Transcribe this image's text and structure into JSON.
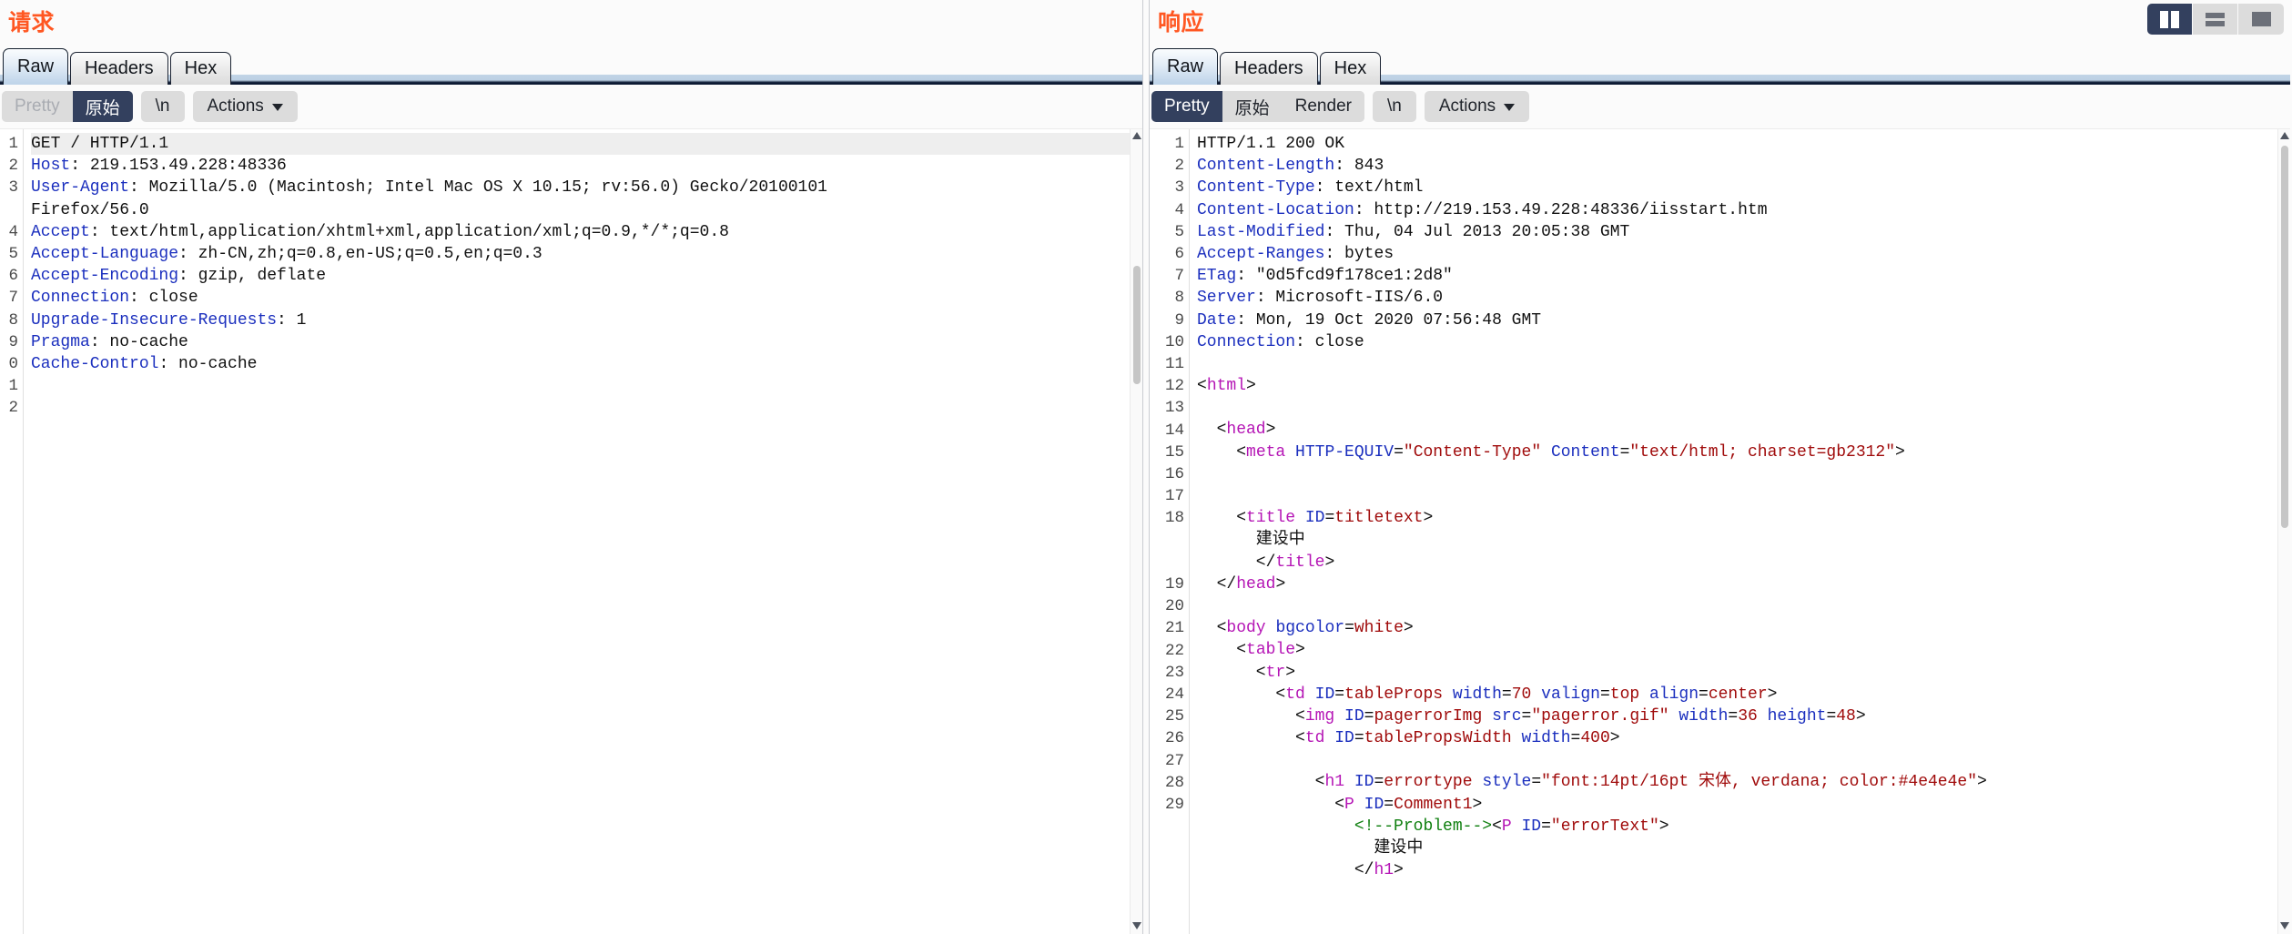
{
  "layout_buttons": [
    {
      "name": "vertical-split",
      "selected": true
    },
    {
      "name": "horizontal-split",
      "selected": false
    },
    {
      "name": "single-pane",
      "selected": false
    }
  ],
  "request": {
    "title": "请求",
    "tabs": [
      {
        "label": "Raw",
        "active": true
      },
      {
        "label": "Headers",
        "active": false
      },
      {
        "label": "Hex",
        "active": false
      }
    ],
    "view_modes": [
      {
        "label": "Pretty",
        "active": false,
        "disabled": true
      },
      {
        "label": "原始",
        "active": true,
        "disabled": false
      }
    ],
    "newline_label": "\\n",
    "actions_label": "Actions",
    "lines": [
      {
        "num": "1",
        "first": true,
        "parts": [
          {
            "t": "txt",
            "s": "GET / HTTP/1.1"
          }
        ]
      },
      {
        "num": "2",
        "parts": [
          {
            "t": "hdr",
            "s": "Host"
          },
          {
            "t": "txt",
            "s": ": 219.153.49.228:48336"
          }
        ]
      },
      {
        "num": "3",
        "parts": [
          {
            "t": "hdr",
            "s": "User-Agent"
          },
          {
            "t": "txt",
            "s": ": Mozilla/5.0 (Macintosh; Intel Mac OS X 10.15; rv:56.0) Gecko/20100101"
          }
        ]
      },
      {
        "num": "",
        "parts": [
          {
            "t": "txt",
            "s": "Firefox/56.0"
          }
        ]
      },
      {
        "num": "4",
        "parts": [
          {
            "t": "hdr",
            "s": "Accept"
          },
          {
            "t": "txt",
            "s": ": text/html,application/xhtml+xml,application/xml;q=0.9,*/*;q=0.8"
          }
        ]
      },
      {
        "num": "5",
        "parts": [
          {
            "t": "hdr",
            "s": "Accept-Language"
          },
          {
            "t": "txt",
            "s": ": zh-CN,zh;q=0.8,en-US;q=0.5,en;q=0.3"
          }
        ]
      },
      {
        "num": "6",
        "parts": [
          {
            "t": "hdr",
            "s": "Accept-Encoding"
          },
          {
            "t": "txt",
            "s": ": gzip, deflate"
          }
        ]
      },
      {
        "num": "7",
        "parts": [
          {
            "t": "hdr",
            "s": "Connection"
          },
          {
            "t": "txt",
            "s": ": close"
          }
        ]
      },
      {
        "num": "8",
        "parts": [
          {
            "t": "hdr",
            "s": "Upgrade-Insecure-Requests"
          },
          {
            "t": "txt",
            "s": ": 1"
          }
        ]
      },
      {
        "num": "9",
        "parts": [
          {
            "t": "hdr",
            "s": "Pragma"
          },
          {
            "t": "txt",
            "s": ": no-cache"
          }
        ]
      },
      {
        "num": "0",
        "parts": [
          {
            "t": "hdr",
            "s": "Cache-Control"
          },
          {
            "t": "txt",
            "s": ": no-cache"
          }
        ]
      },
      {
        "num": "1",
        "parts": []
      },
      {
        "num": "2",
        "parts": []
      }
    ]
  },
  "response": {
    "title": "响应",
    "tabs": [
      {
        "label": "Raw",
        "active": true
      },
      {
        "label": "Headers",
        "active": false
      },
      {
        "label": "Hex",
        "active": false
      }
    ],
    "view_modes": [
      {
        "label": "Pretty",
        "active": true,
        "disabled": false
      },
      {
        "label": "原始",
        "active": false,
        "disabled": false
      },
      {
        "label": "Render",
        "active": false,
        "disabled": false
      }
    ],
    "newline_label": "\\n",
    "actions_label": "Actions",
    "lines": [
      {
        "num": "1",
        "parts": [
          {
            "t": "txt",
            "s": "HTTP/1.1 200 OK"
          }
        ]
      },
      {
        "num": "2",
        "parts": [
          {
            "t": "hdr",
            "s": "Content-Length"
          },
          {
            "t": "txt",
            "s": ": 843"
          }
        ]
      },
      {
        "num": "3",
        "parts": [
          {
            "t": "hdr",
            "s": "Content-Type"
          },
          {
            "t": "txt",
            "s": ": text/html"
          }
        ]
      },
      {
        "num": "4",
        "parts": [
          {
            "t": "hdr",
            "s": "Content-Location"
          },
          {
            "t": "txt",
            "s": ": http://219.153.49.228:48336/iisstart.htm"
          }
        ]
      },
      {
        "num": "5",
        "parts": [
          {
            "t": "hdr",
            "s": "Last-Modified"
          },
          {
            "t": "txt",
            "s": ": Thu, 04 Jul 2013 20:05:38 GMT"
          }
        ]
      },
      {
        "num": "6",
        "parts": [
          {
            "t": "hdr",
            "s": "Accept-Ranges"
          },
          {
            "t": "txt",
            "s": ": bytes"
          }
        ]
      },
      {
        "num": "7",
        "parts": [
          {
            "t": "hdr",
            "s": "ETag"
          },
          {
            "t": "txt",
            "s": ": \"0d5fcd9f178ce1:2d8\""
          }
        ]
      },
      {
        "num": "8",
        "parts": [
          {
            "t": "hdr",
            "s": "Server"
          },
          {
            "t": "txt",
            "s": ": Microsoft-IIS/6.0"
          }
        ]
      },
      {
        "num": "9",
        "parts": [
          {
            "t": "hdr",
            "s": "Date"
          },
          {
            "t": "txt",
            "s": ": Mon, 19 Oct 2020 07:56:48 GMT"
          }
        ]
      },
      {
        "num": "10",
        "parts": [
          {
            "t": "hdr",
            "s": "Connection"
          },
          {
            "t": "txt",
            "s": ": close"
          }
        ]
      },
      {
        "num": "11",
        "parts": []
      },
      {
        "num": "12",
        "parts": [
          {
            "t": "txt",
            "s": "<"
          },
          {
            "t": "tag",
            "s": "html"
          },
          {
            "t": "txt",
            "s": ">"
          }
        ]
      },
      {
        "num": "13",
        "parts": []
      },
      {
        "num": "14",
        "parts": [
          {
            "t": "txt",
            "s": "  <"
          },
          {
            "t": "tag",
            "s": "head"
          },
          {
            "t": "txt",
            "s": ">"
          }
        ]
      },
      {
        "num": "15",
        "parts": [
          {
            "t": "txt",
            "s": "    <"
          },
          {
            "t": "tag",
            "s": "meta"
          },
          {
            "t": "txt",
            "s": " "
          },
          {
            "t": "attr",
            "s": "HTTP-EQUIV"
          },
          {
            "t": "txt",
            "s": "="
          },
          {
            "t": "val",
            "s": "\"Content-Type\""
          },
          {
            "t": "txt",
            "s": " "
          },
          {
            "t": "attr",
            "s": "Content"
          },
          {
            "t": "txt",
            "s": "="
          },
          {
            "t": "val",
            "s": "\"text/html; charset=gb2312\""
          },
          {
            "t": "txt",
            "s": ">"
          }
        ]
      },
      {
        "num": "16",
        "parts": []
      },
      {
        "num": "17",
        "parts": []
      },
      {
        "num": "18",
        "parts": [
          {
            "t": "txt",
            "s": "    <"
          },
          {
            "t": "tag",
            "s": "title"
          },
          {
            "t": "txt",
            "s": " "
          },
          {
            "t": "attr",
            "s": "ID"
          },
          {
            "t": "txt",
            "s": "="
          },
          {
            "t": "val",
            "s": "titletext"
          },
          {
            "t": "txt",
            "s": ">"
          }
        ]
      },
      {
        "num": "",
        "parts": [
          {
            "t": "txt",
            "s": "      建设中"
          }
        ]
      },
      {
        "num": "",
        "parts": [
          {
            "t": "txt",
            "s": "      </"
          },
          {
            "t": "tag",
            "s": "title"
          },
          {
            "t": "txt",
            "s": ">"
          }
        ]
      },
      {
        "num": "19",
        "parts": [
          {
            "t": "txt",
            "s": "  </"
          },
          {
            "t": "tag",
            "s": "head"
          },
          {
            "t": "txt",
            "s": ">"
          }
        ]
      },
      {
        "num": "20",
        "parts": []
      },
      {
        "num": "21",
        "parts": [
          {
            "t": "txt",
            "s": "  <"
          },
          {
            "t": "tag",
            "s": "body"
          },
          {
            "t": "txt",
            "s": " "
          },
          {
            "t": "attr",
            "s": "bgcolor"
          },
          {
            "t": "txt",
            "s": "="
          },
          {
            "t": "val",
            "s": "white"
          },
          {
            "t": "txt",
            "s": ">"
          }
        ]
      },
      {
        "num": "22",
        "parts": [
          {
            "t": "txt",
            "s": "    <"
          },
          {
            "t": "tag",
            "s": "table"
          },
          {
            "t": "txt",
            "s": ">"
          }
        ]
      },
      {
        "num": "23",
        "parts": [
          {
            "t": "txt",
            "s": "      <"
          },
          {
            "t": "tag",
            "s": "tr"
          },
          {
            "t": "txt",
            "s": ">"
          }
        ]
      },
      {
        "num": "24",
        "parts": [
          {
            "t": "txt",
            "s": "        <"
          },
          {
            "t": "tag",
            "s": "td"
          },
          {
            "t": "txt",
            "s": " "
          },
          {
            "t": "attr",
            "s": "ID"
          },
          {
            "t": "txt",
            "s": "="
          },
          {
            "t": "val",
            "s": "tableProps"
          },
          {
            "t": "txt",
            "s": " "
          },
          {
            "t": "attr",
            "s": "width"
          },
          {
            "t": "txt",
            "s": "="
          },
          {
            "t": "val",
            "s": "70"
          },
          {
            "t": "txt",
            "s": " "
          },
          {
            "t": "attr",
            "s": "valign"
          },
          {
            "t": "txt",
            "s": "="
          },
          {
            "t": "val",
            "s": "top"
          },
          {
            "t": "txt",
            "s": " "
          },
          {
            "t": "attr",
            "s": "align"
          },
          {
            "t": "txt",
            "s": "="
          },
          {
            "t": "val",
            "s": "center"
          },
          {
            "t": "txt",
            "s": ">"
          }
        ]
      },
      {
        "num": "25",
        "parts": [
          {
            "t": "txt",
            "s": "          <"
          },
          {
            "t": "tag",
            "s": "img"
          },
          {
            "t": "txt",
            "s": " "
          },
          {
            "t": "attr",
            "s": "ID"
          },
          {
            "t": "txt",
            "s": "="
          },
          {
            "t": "val",
            "s": "pagerrorImg"
          },
          {
            "t": "txt",
            "s": " "
          },
          {
            "t": "attr",
            "s": "src"
          },
          {
            "t": "txt",
            "s": "="
          },
          {
            "t": "val",
            "s": "\"pagerror.gif\""
          },
          {
            "t": "txt",
            "s": " "
          },
          {
            "t": "attr",
            "s": "width"
          },
          {
            "t": "txt",
            "s": "="
          },
          {
            "t": "val",
            "s": "36"
          },
          {
            "t": "txt",
            "s": " "
          },
          {
            "t": "attr",
            "s": "height"
          },
          {
            "t": "txt",
            "s": "="
          },
          {
            "t": "val",
            "s": "48"
          },
          {
            "t": "txt",
            "s": ">"
          }
        ]
      },
      {
        "num": "26",
        "parts": [
          {
            "t": "txt",
            "s": "          <"
          },
          {
            "t": "tag",
            "s": "td"
          },
          {
            "t": "txt",
            "s": " "
          },
          {
            "t": "attr",
            "s": "ID"
          },
          {
            "t": "txt",
            "s": "="
          },
          {
            "t": "val",
            "s": "tablePropsWidth"
          },
          {
            "t": "txt",
            "s": " "
          },
          {
            "t": "attr",
            "s": "width"
          },
          {
            "t": "txt",
            "s": "="
          },
          {
            "t": "val",
            "s": "400"
          },
          {
            "t": "txt",
            "s": ">"
          }
        ]
      },
      {
        "num": "27",
        "parts": []
      },
      {
        "num": "28",
        "parts": [
          {
            "t": "txt",
            "s": "            <"
          },
          {
            "t": "tag",
            "s": "h1"
          },
          {
            "t": "txt",
            "s": " "
          },
          {
            "t": "attr",
            "s": "ID"
          },
          {
            "t": "txt",
            "s": "="
          },
          {
            "t": "val",
            "s": "errortype"
          },
          {
            "t": "txt",
            "s": " "
          },
          {
            "t": "attr",
            "s": "style"
          },
          {
            "t": "txt",
            "s": "="
          },
          {
            "t": "val",
            "s": "\"font:14pt/16pt 宋体, verdana; color:#4e4e4e\""
          },
          {
            "t": "txt",
            "s": ">"
          }
        ]
      },
      {
        "num": "29",
        "parts": [
          {
            "t": "txt",
            "s": "              <"
          },
          {
            "t": "tag",
            "s": "P"
          },
          {
            "t": "txt",
            "s": " "
          },
          {
            "t": "attr",
            "s": "ID"
          },
          {
            "t": "txt",
            "s": "="
          },
          {
            "t": "val",
            "s": "Comment1"
          },
          {
            "t": "txt",
            "s": ">"
          }
        ]
      },
      {
        "num": "",
        "parts": [
          {
            "t": "txt",
            "s": "                "
          },
          {
            "t": "cmt",
            "s": "<!--Problem-->"
          },
          {
            "t": "txt",
            "s": "<"
          },
          {
            "t": "tag",
            "s": "P"
          },
          {
            "t": "txt",
            "s": " "
          },
          {
            "t": "attr",
            "s": "ID"
          },
          {
            "t": "txt",
            "s": "="
          },
          {
            "t": "val",
            "s": "\"errorText\""
          },
          {
            "t": "txt",
            "s": ">"
          }
        ]
      },
      {
        "num": "",
        "parts": [
          {
            "t": "txt",
            "s": "                  建设中"
          }
        ]
      },
      {
        "num": "",
        "parts": [
          {
            "t": "txt",
            "s": "                </"
          },
          {
            "t": "tag",
            "s": "h1"
          },
          {
            "t": "txt",
            "s": ">"
          }
        ]
      }
    ]
  }
}
